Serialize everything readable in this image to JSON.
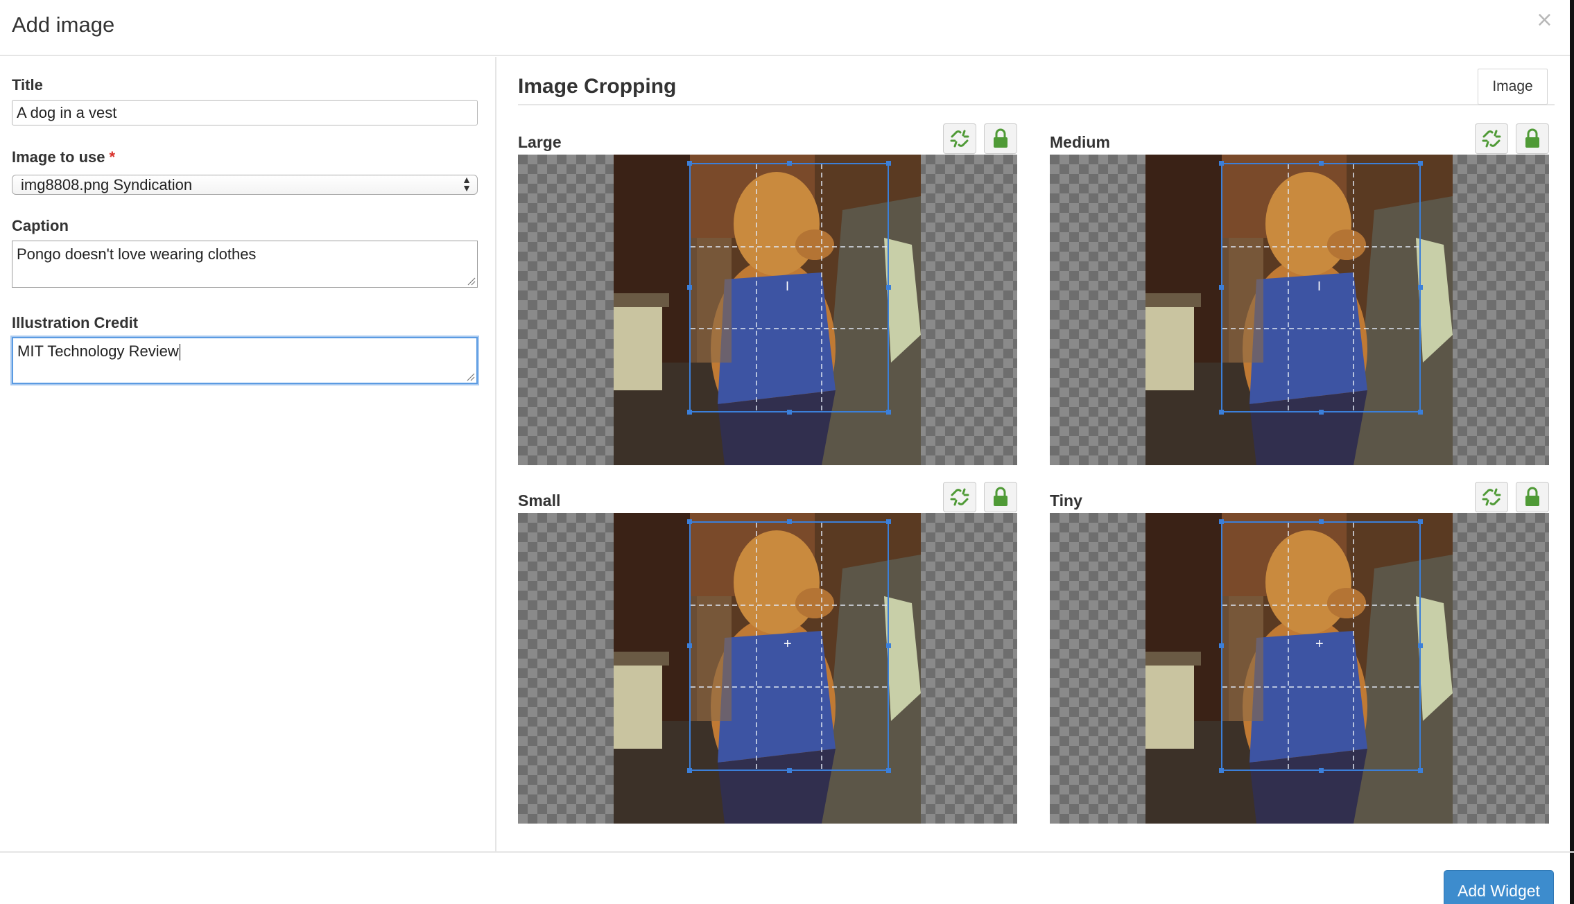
{
  "dialog": {
    "title": "Add image",
    "close_glyph": "×"
  },
  "form": {
    "title_label": "Title",
    "title_value": "A dog in a vest",
    "image_label": "Image to use",
    "required_marker": "*",
    "image_value": "img8808.png Syndication",
    "caption_label": "Caption",
    "caption_value": "Pongo doesn't love wearing clothes",
    "credit_label": "Illustration Credit",
    "credit_value": "MIT Technology Review"
  },
  "cropping": {
    "heading": "Image Cropping",
    "image_button": "Image",
    "panels": [
      {
        "label": "Large",
        "unlink_icon": "unlink-icon",
        "lock_icon": "lock-icon",
        "center_mark": "I"
      },
      {
        "label": "Medium",
        "unlink_icon": "unlink-icon",
        "lock_icon": "lock-icon",
        "center_mark": "I"
      },
      {
        "label": "Small",
        "unlink_icon": "unlink-icon",
        "lock_icon": "lock-icon",
        "center_mark": "+"
      },
      {
        "label": "Tiny",
        "unlink_icon": "unlink-icon",
        "lock_icon": "lock-icon",
        "center_mark": "+"
      }
    ]
  },
  "footer": {
    "add_widget_label": "Add Widget"
  },
  "colors": {
    "accent": "#3d8ccd",
    "crop_outline": "#3b7fd9",
    "lock_green": "#4f9a36",
    "required": "#d9302a"
  }
}
